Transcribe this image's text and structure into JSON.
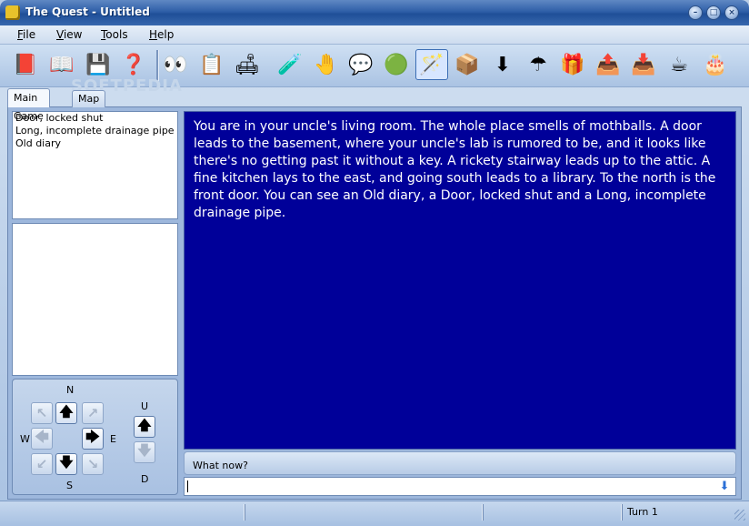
{
  "window": {
    "title": "The Quest - Untitled"
  },
  "menu": [
    {
      "key": "F",
      "rest": "ile"
    },
    {
      "key": "V",
      "rest": "iew"
    },
    {
      "key": "T",
      "rest": "ools"
    },
    {
      "key": "H",
      "rest": "elp"
    }
  ],
  "toolbar": [
    {
      "icon": "red-book-icon",
      "glyph": "📕"
    },
    {
      "icon": "open-book-icon",
      "glyph": "📖"
    },
    {
      "icon": "save-disk-icon",
      "glyph": "💾"
    },
    {
      "icon": "help-question-icon",
      "glyph": "❓"
    },
    {
      "icon": "eyes-look-icon",
      "glyph": "👀"
    },
    {
      "icon": "checklist-icon",
      "glyph": "📋"
    },
    {
      "icon": "room-furniture-icon",
      "glyph": "🛋"
    },
    {
      "icon": "push-bottle-icon",
      "glyph": "🧪"
    },
    {
      "icon": "red-hand-icon",
      "glyph": "🤚"
    },
    {
      "icon": "speech-bubble-icon",
      "glyph": "💬"
    },
    {
      "icon": "green-ball-icon",
      "glyph": "🟢"
    },
    {
      "icon": "use-wand-icon",
      "glyph": "🪄"
    },
    {
      "icon": "give-cube-icon",
      "glyph": "📦"
    },
    {
      "icon": "drop-down-icon",
      "glyph": "⬇"
    },
    {
      "icon": "umbrella-icon",
      "glyph": "☂"
    },
    {
      "icon": "gift-box-icon",
      "glyph": "🎁"
    },
    {
      "icon": "open-container-icon",
      "glyph": "📤"
    },
    {
      "icon": "close-container-icon",
      "glyph": "📥"
    },
    {
      "icon": "teacup-icon",
      "glyph": "☕"
    },
    {
      "icon": "cake-icon",
      "glyph": "🎂"
    }
  ],
  "tabs": [
    "Main Game",
    "Map"
  ],
  "objects": [
    "Door, locked shut",
    "Long, incomplete drainage pipe",
    "Old diary"
  ],
  "compass": {
    "n": "N",
    "s": "S",
    "e": "E",
    "w": "W",
    "u": "U",
    "d": "D"
  },
  "room_description": "You are in your uncle's living room. The whole place smells of mothballs. A door leads to the basement, where your uncle's lab is rumored to be, and it looks like there's no getting past it without a key. A rickety stairway leads up to the attic. A fine kitchen lays to the east, and going south leads to a library. To the north is the front door. You can see an Old diary, a Door, locked shut and a Long, incomplete drainage pipe.",
  "prompt": {
    "label": "What now?",
    "value": ""
  },
  "status": {
    "turn": "Turn 1"
  },
  "watermark": "SOFTPEDIA"
}
